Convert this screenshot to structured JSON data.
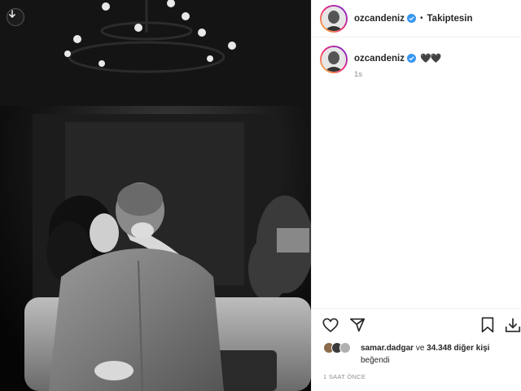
{
  "post": {
    "username": "ozcandeniz",
    "follow_status": "Takiptesin",
    "caption": "🖤🖤",
    "caption_time": "1s",
    "liked_by_user": "samar.dadgar",
    "likes_connector": "ve",
    "likes_count": "34.348 diğer kişi",
    "likes_suffix": "beğendi",
    "posted_ago": "1 SAAT ÖNCE"
  },
  "colors": {
    "verified": "#3897f0",
    "muted": "#8e8e8e",
    "text": "#262626"
  },
  "icons": {
    "download": "download-icon",
    "like": "heart-icon",
    "share": "send-icon",
    "save": "bookmark-icon",
    "more": "download-tray-icon"
  }
}
